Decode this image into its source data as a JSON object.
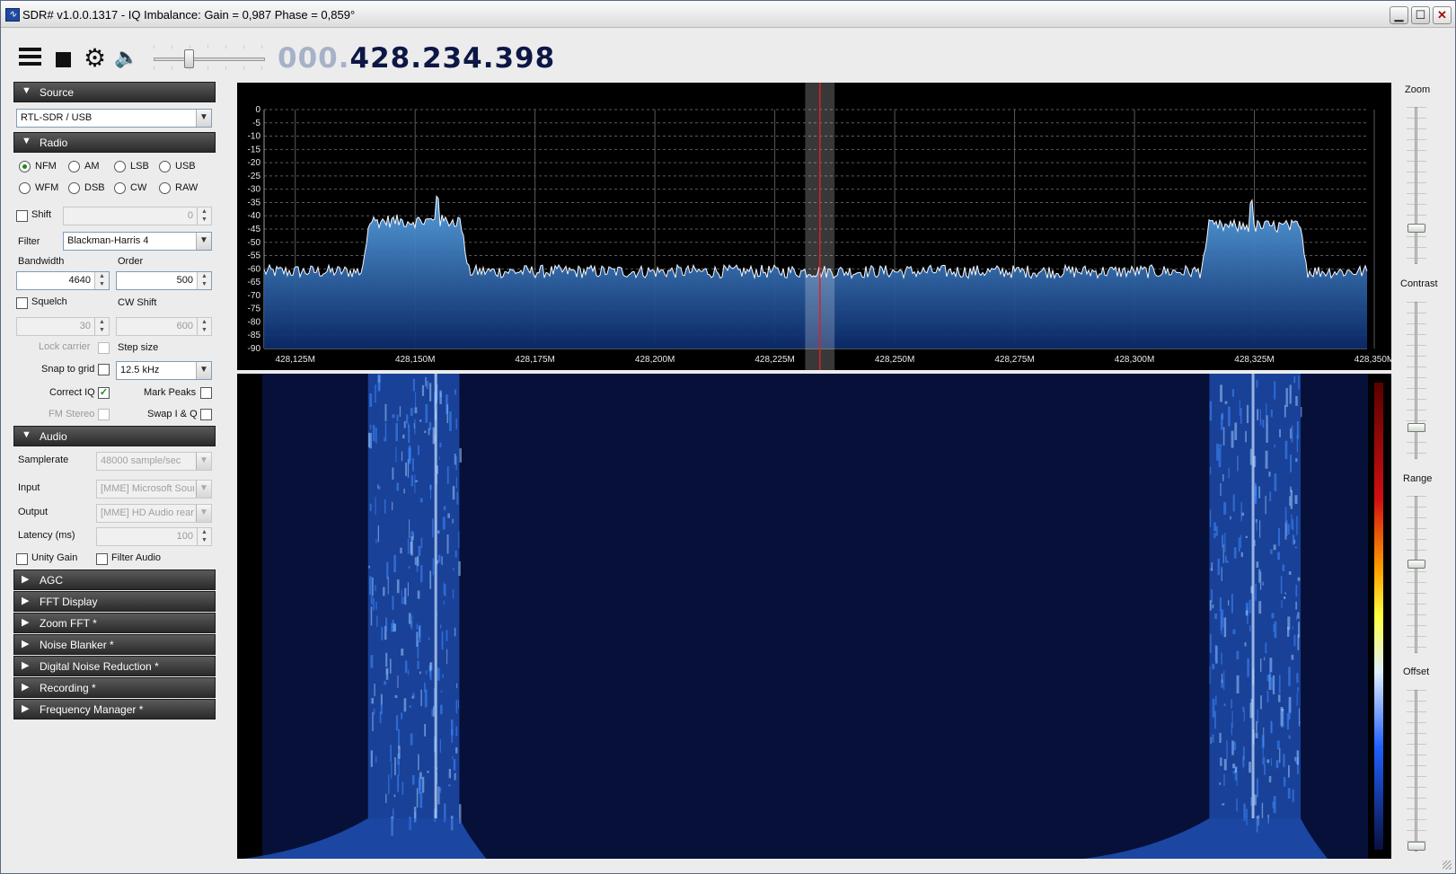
{
  "window": {
    "title": "SDR# v1.0.0.1317 - IQ Imbalance: Gain = 0,987 Phase = 0,859°",
    "buttons": {
      "minimize": "▁",
      "maximize": "☐",
      "close": "✕"
    }
  },
  "toolbar": {
    "icons": [
      "menu-icon",
      "stop-icon",
      "gear-icon",
      "speaker-icon"
    ],
    "volume_level": 0.3,
    "frequency_dim": "000.",
    "frequency_main": "428.234.398"
  },
  "source": {
    "header": "Source",
    "device": "RTL-SDR / USB"
  },
  "radio": {
    "header": "Radio",
    "modes": [
      "NFM",
      "AM",
      "LSB",
      "USB",
      "WFM",
      "DSB",
      "CW",
      "RAW"
    ],
    "selected_mode": "NFM",
    "shift_label": "Shift",
    "shift_value": "0",
    "filter_label": "Filter",
    "filter_value": "Blackman-Harris 4",
    "bandwidth_label": "Bandwidth",
    "bandwidth_value": "4640",
    "order_label": "Order",
    "order_value": "500",
    "squelch_label": "Squelch",
    "squelch_value": "30",
    "cw_shift_label": "CW Shift",
    "cw_shift_value": "600",
    "lock_carrier_label": "Lock carrier",
    "step_size_label": "Step size",
    "snap_to_grid_label": "Snap to grid",
    "step_size_value": "12.5 kHz",
    "correct_iq_label": "Correct IQ",
    "mark_peaks_label": "Mark Peaks",
    "fm_stereo_label": "FM Stereo",
    "swap_iq_label": "Swap I & Q",
    "check_mark": "✓"
  },
  "audio": {
    "header": "Audio",
    "samplerate_label": "Samplerate",
    "samplerate_value": "48000 sample/sec",
    "input_label": "Input",
    "input_value": "[MME] Microsoft Soun",
    "output_label": "Output",
    "output_value": "[MME] HD Audio rear",
    "latency_label": "Latency (ms)",
    "latency_value": "100",
    "unity_gain_label": "Unity Gain",
    "filter_audio_label": "Filter Audio"
  },
  "collapsed_sections": [
    "AGC",
    "FFT Display",
    "Zoom FFT *",
    "Noise Blanker *",
    "Digital Noise Reduction *",
    "Recording *",
    "Frequency Manager *"
  ],
  "arrows": {
    "expanded": "▼",
    "collapsed": "▶",
    "combo": "▼",
    "spin_up": "▲",
    "spin_down": "▼"
  },
  "right_panel": {
    "zoom_label": "Zoom",
    "contrast_label": "Contrast",
    "range_label": "Range",
    "offset_label": "Offset"
  },
  "colors": {
    "spectrum_fill_top": "#5aa6e6",
    "spectrum_fill_bottom": "#0a2a6a",
    "waterfall_background": "#061038",
    "signal_color": "#2a6ae8",
    "tuning_line": "#e02020"
  },
  "chart_data": {
    "type": "area",
    "y_ticks": [
      0,
      -5,
      -10,
      -15,
      -20,
      -25,
      -30,
      -35,
      -40,
      -45,
      -50,
      -55,
      -60,
      -65,
      -70,
      -75,
      -80,
      -85,
      -90
    ],
    "ylim": [
      -90,
      0
    ],
    "x_ticks": [
      "428,125M",
      "428,150M",
      "428,175M",
      "428,200M",
      "428,225M",
      "428,250M",
      "428,275M",
      "428,300M",
      "428,325M",
      "428,350M"
    ],
    "x_tick_values_mhz": [
      428.125,
      428.15,
      428.175,
      428.2,
      428.225,
      428.25,
      428.275,
      428.3,
      428.325,
      428.35
    ],
    "xlim_mhz": [
      428.1185,
      428.3485
    ],
    "noise_floor_db": -61,
    "signals": [
      {
        "start_mhz": 428.1405,
        "end_mhz": 428.1595,
        "level_db": -42,
        "peak_mhz": 428.1545,
        "peak_db": -33
      },
      {
        "start_mhz": 428.3155,
        "end_mhz": 428.3345,
        "level_db": -44,
        "peak_mhz": 428.3245,
        "peak_db": -35
      }
    ],
    "tuned_frequency_mhz": 428.234398,
    "filter_bandwidth_khz": 4.64,
    "grid": true
  }
}
